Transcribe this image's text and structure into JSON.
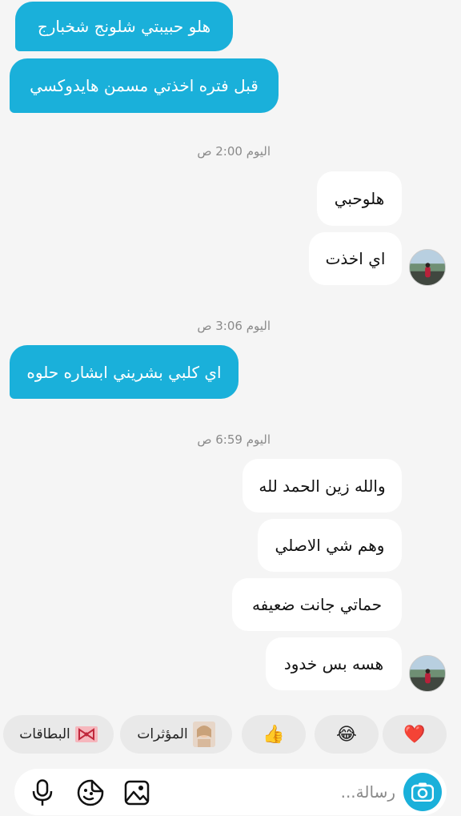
{
  "messages": [
    {
      "text": "هلو حبيبتي شلونج شخبارج"
    },
    {
      "text": "قبل فتره اخذتي مسمن هايدوكسي"
    },
    {
      "text": "هلوحبي"
    },
    {
      "text": "اي اخذت"
    },
    {
      "text": "اي كلبي بشريني ابشاره حلوه"
    },
    {
      "text": "والله زين الحمد لله"
    },
    {
      "text": "وهم شي الاصلي"
    },
    {
      "text": "حماتي جانت ضعيفه"
    },
    {
      "text": "هسه بس خدود"
    }
  ],
  "timestamps": [
    {
      "day": "اليوم",
      "time": "2:00 ص"
    },
    {
      "day": "اليوم",
      "time": "3:06 ص"
    },
    {
      "day": "اليوم",
      "time": "6:59 ص"
    }
  ],
  "quick_replies": {
    "heart": "❤️",
    "laugh": "😂",
    "thumbs": "👍",
    "effects_label": "المؤثرات",
    "cards_label": "البطاقات"
  },
  "composer": {
    "placeholder": "رسالة..."
  },
  "colors": {
    "incoming_bubble": "#1ab0da",
    "outgoing_bubble": "#ffffff",
    "background": "#f5f5f5"
  },
  "icons": [
    "camera-icon",
    "gallery-icon",
    "sticker-icon",
    "microphone-icon",
    "bow-icon",
    "avatar-icon"
  ]
}
